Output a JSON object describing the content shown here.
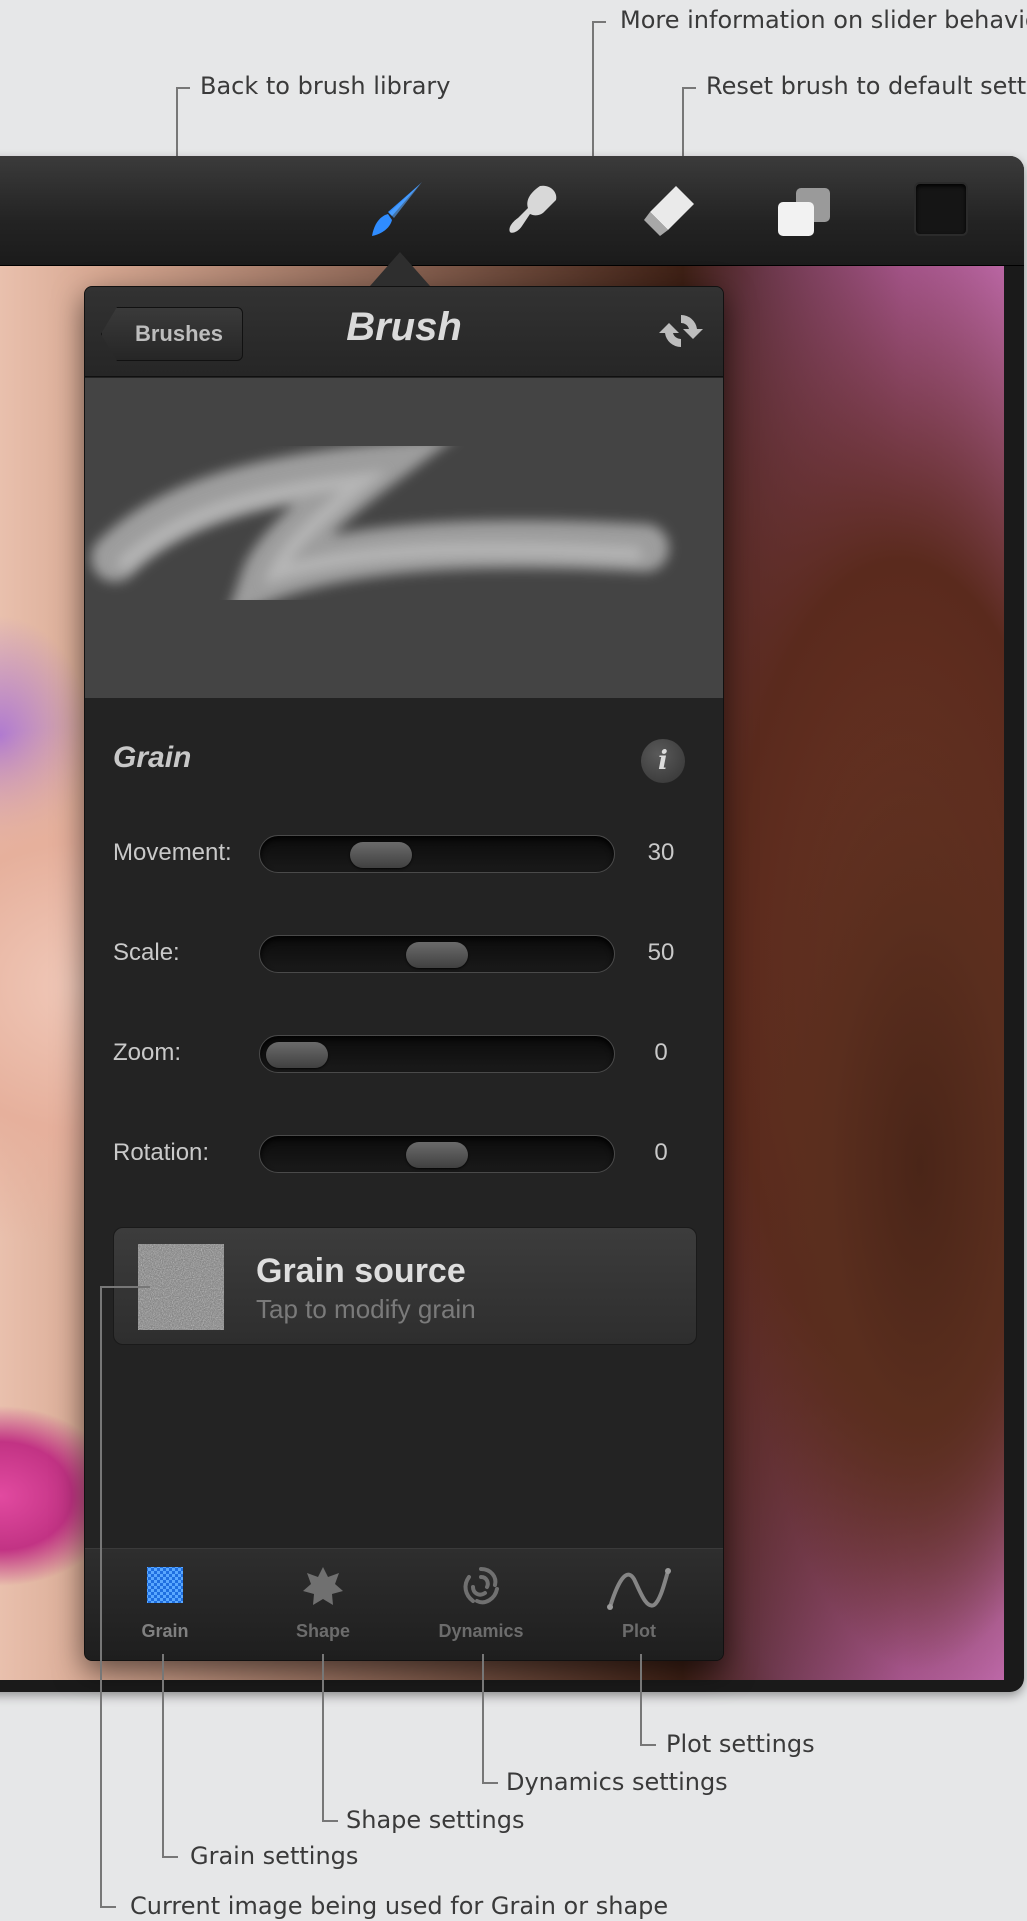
{
  "annotations": {
    "info": "More information on slider behaviour",
    "back": "Back to brush library",
    "reset": "Reset brush to default settings",
    "plot": "Plot settings",
    "dynamics": "Dynamics settings",
    "shape": "Shape settings",
    "grain": "Grain settings",
    "current_image": "Current image being used for Grain or shape"
  },
  "toolbar": {
    "tools": [
      "brush-icon",
      "smudge-icon",
      "eraser-icon",
      "layers-icon",
      "color-swatch"
    ],
    "active_tool": "brush",
    "accent": "#2f8cff"
  },
  "panel": {
    "back_label": "Brushes",
    "title": "Brush",
    "section_title": "Grain",
    "info_label": "i",
    "sliders": [
      {
        "label": "Movement:",
        "value": "30",
        "level": 0.3
      },
      {
        "label": "Scale:",
        "value": "50",
        "level": 0.5
      },
      {
        "label": "Zoom:",
        "value": "0",
        "level": 0.0
      },
      {
        "label": "Rotation:",
        "value": "0",
        "level": 0.5
      }
    ],
    "grain_source": {
      "title": "Grain source",
      "subtitle": "Tap to modify grain"
    },
    "tabs": [
      {
        "label": "Grain",
        "icon": "grain-icon",
        "active": true
      },
      {
        "label": "Shape",
        "icon": "shape-icon",
        "active": false
      },
      {
        "label": "Dynamics",
        "icon": "dynamics-icon",
        "active": false
      },
      {
        "label": "Plot",
        "icon": "plot-icon",
        "active": false
      }
    ]
  }
}
